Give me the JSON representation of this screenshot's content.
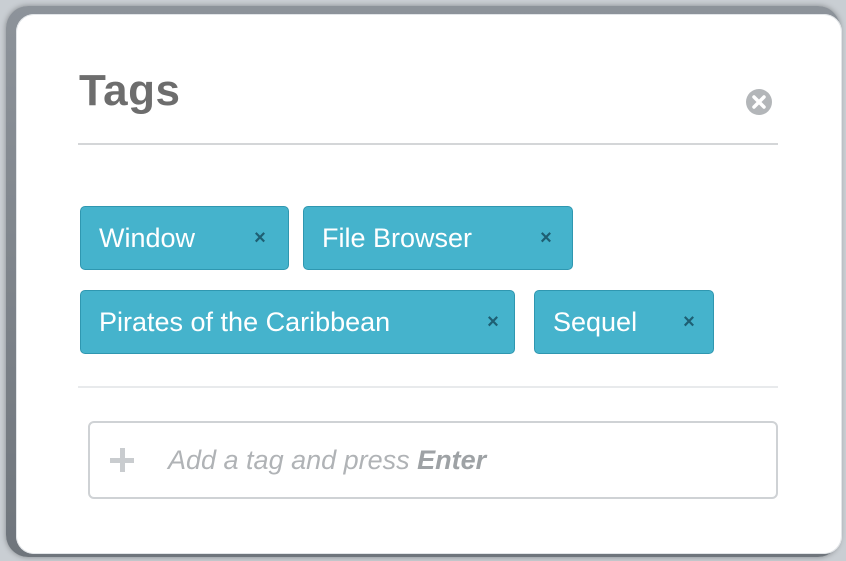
{
  "panel": {
    "title": "Tags",
    "close_icon": "close-circle-icon"
  },
  "tags": [
    {
      "label": "Window",
      "remove": "×"
    },
    {
      "label": "File Browser",
      "remove": "×"
    },
    {
      "label": "Pirates of the Caribbean",
      "remove": "×"
    },
    {
      "label": "Sequel",
      "remove": "×"
    }
  ],
  "input": {
    "icon": "plus-icon",
    "placeholder_text": "Add a tag and press ",
    "placeholder_key": "Enter"
  },
  "colors": {
    "tag_bg": "#45b3cc",
    "tag_border": "#2f97b0",
    "title": "#6d6d6d"
  }
}
